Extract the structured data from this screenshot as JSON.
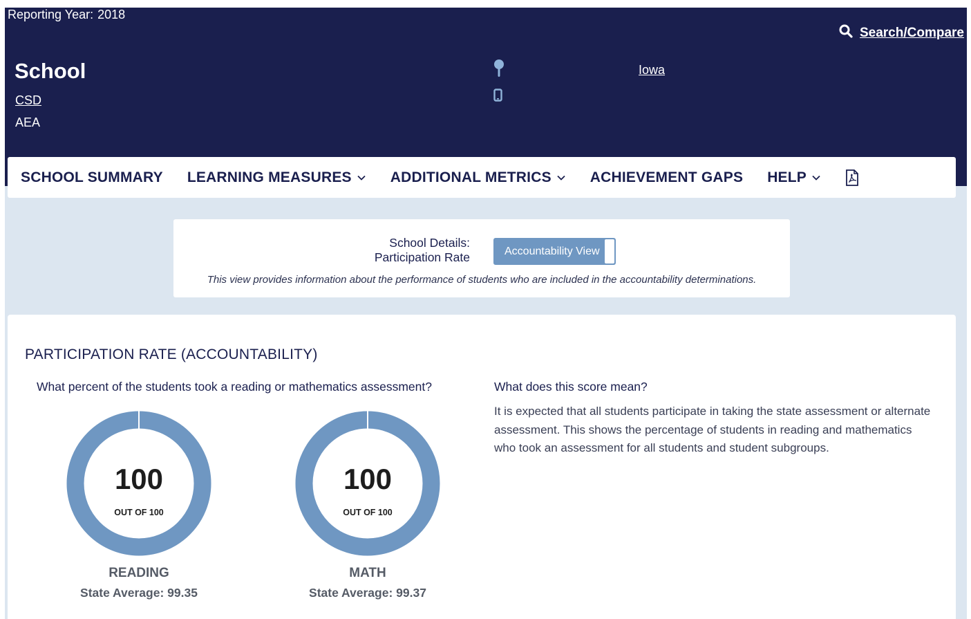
{
  "header": {
    "reporting_label": "Reporting Year:",
    "reporting_year": "2018",
    "search_label": "Search/Compare",
    "school_name": "School",
    "district": "CSD",
    "aea": "AEA",
    "state": "Iowa"
  },
  "nav": {
    "items": [
      {
        "label": "SCHOOL SUMMARY",
        "dropdown": false
      },
      {
        "label": "LEARNING MEASURES",
        "dropdown": true
      },
      {
        "label": "ADDITIONAL METRICS",
        "dropdown": true
      },
      {
        "label": "ACHIEVEMENT GAPS",
        "dropdown": false
      },
      {
        "label": "HELP",
        "dropdown": true
      }
    ],
    "pdf_icon": "pdf-icon"
  },
  "details": {
    "title_line1": "School Details:",
    "title_line2": "Participation Rate",
    "view_button": "Accountability View",
    "description": "This view provides information about the performance of students who are included in the accountability determinations."
  },
  "card": {
    "title": "PARTICIPATION RATE (ACCOUNTABILITY)",
    "question": "What percent of the students took a reading or mathematics assessment?",
    "meaning_title": "What does this score mean?",
    "meaning_text": "It is expected that all students participate in taking the state assessment or alternate assessment. This shows the percentage of students in reading and mathematics who took an assessment for all students and student subgroups.",
    "gauges": [
      {
        "value": "100",
        "out_of": "OUT OF 100",
        "subject": "READING",
        "state_avg": "State Average: 99.35",
        "percent": 100
      },
      {
        "value": "100",
        "out_of": "OUT OF 100",
        "subject": "MATH",
        "state_avg": "State Average: 99.37",
        "percent": 100
      }
    ]
  },
  "colors": {
    "header_bg": "#1a1f4e",
    "page_bg": "#dce6f0",
    "gauge_fill": "#6f97c2",
    "button_bg": "#6f97c2"
  }
}
